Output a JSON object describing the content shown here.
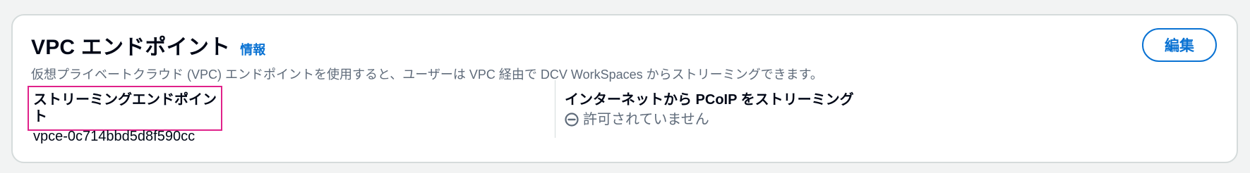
{
  "header": {
    "title": "VPC エンドポイント",
    "info_link": "情報",
    "edit_button": "編集"
  },
  "description": "仮想プライベートクラウド (VPC) エンドポイントを使用すると、ユーザーは VPC 経由で DCV WorkSpaces からストリーミングできます。",
  "fields": {
    "streaming_endpoint": {
      "label": "ストリーミングエンドポイント",
      "value": "vpce-0c714bbd5d8f590cc"
    },
    "internet_pcoip": {
      "label": "インターネットから PCoIP をストリーミング",
      "status_icon": "not-allowed-icon",
      "value": "許可されていません"
    }
  },
  "colors": {
    "accent": "#0972d3",
    "highlight_border": "#e0218a",
    "text_primary": "#000716",
    "text_secondary": "#5f6b7a"
  }
}
